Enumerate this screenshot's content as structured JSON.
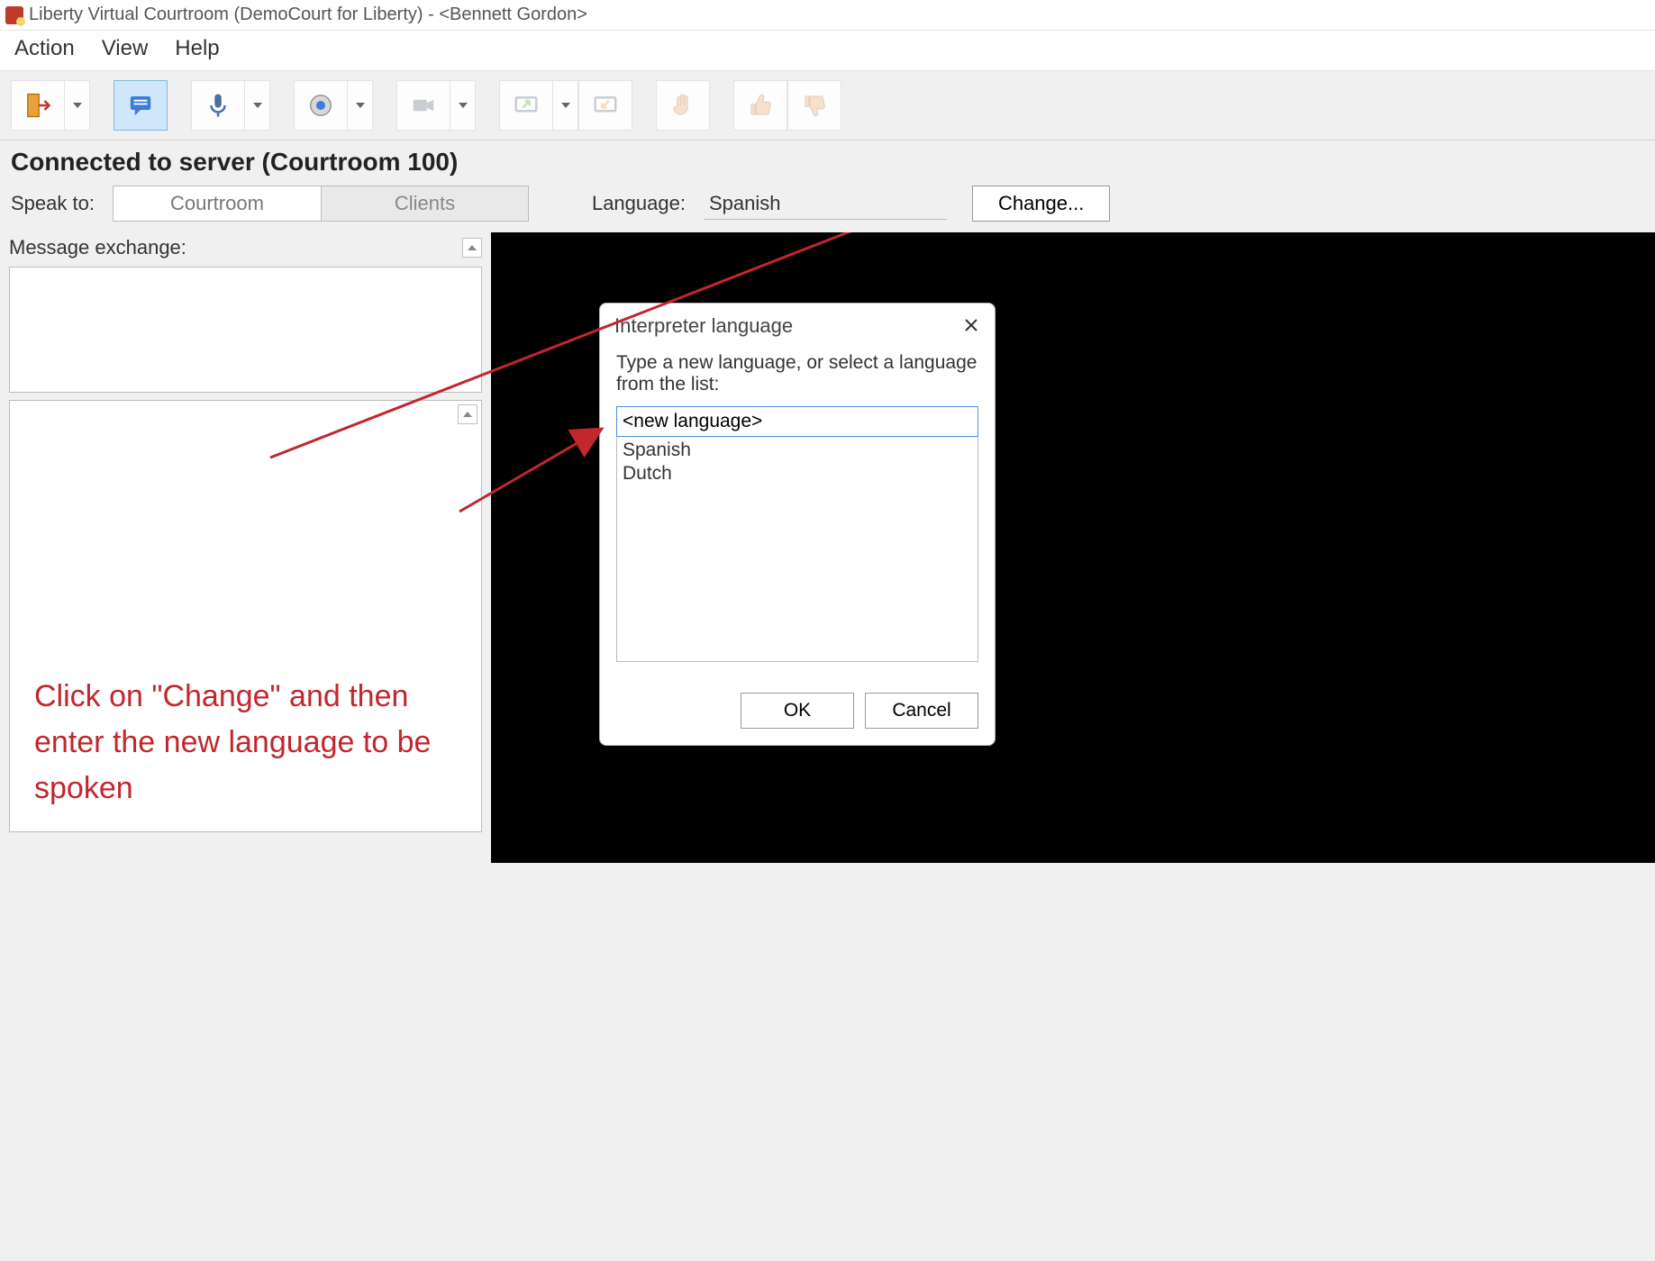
{
  "window": {
    "title": "Liberty Virtual Courtroom (DemoCourt for Liberty) - <Bennett Gordon>"
  },
  "menu": {
    "action": "Action",
    "view": "View",
    "help": "Help"
  },
  "toolbar": {
    "door_icon": "door-exit-icon",
    "chat_icon": "chat-icon",
    "mic_icon": "microphone-icon",
    "speaker_icon": "speaker-icon",
    "camera_icon": "video-camera-icon",
    "screen_icon_1": "screen-share-icon",
    "screen_icon_2": "screen-receive-icon",
    "hand_icon": "raise-hand-icon",
    "thumbs_up_icon": "thumbs-up-icon",
    "thumbs_down_icon": "thumbs-down-icon"
  },
  "status": "Connected to server (Courtroom 100)",
  "controls": {
    "speak_to_label": "Speak to:",
    "tab_courtroom": "Courtroom",
    "tab_clients": "Clients",
    "language_label": "Language:",
    "language_value": "Spanish",
    "change_label": "Change..."
  },
  "message": {
    "exchange_label": "Message exchange:"
  },
  "annotation": "Click on \"Change\" and then enter the new language to be spoken",
  "dialog": {
    "title": "Interpreter language",
    "prompt": "Type a new language, or select a language from the list:",
    "input_value": "<new language>",
    "options": [
      "Spanish",
      "Dutch"
    ],
    "ok_label": "OK",
    "cancel_label": "Cancel"
  }
}
